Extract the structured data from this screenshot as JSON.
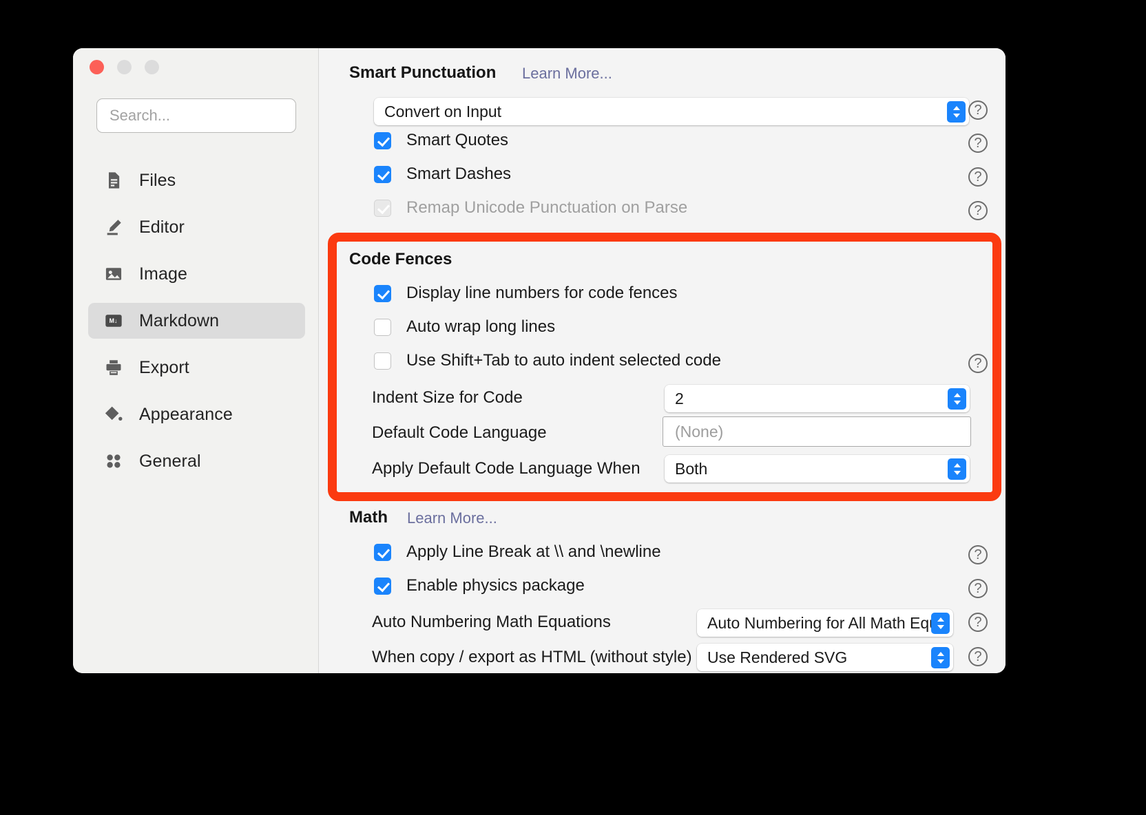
{
  "window": {
    "traffic_lights": [
      "close",
      "minimize",
      "zoom"
    ]
  },
  "sidebar": {
    "search": {
      "placeholder": "Search...",
      "value": ""
    },
    "items": [
      {
        "label": "Files",
        "icon": "file-document-icon",
        "selected": false
      },
      {
        "label": "Editor",
        "icon": "pencil-icon",
        "selected": false
      },
      {
        "label": "Image",
        "icon": "image-icon",
        "selected": false
      },
      {
        "label": "Markdown",
        "icon": "markdown-icon",
        "selected": true
      },
      {
        "label": "Export",
        "icon": "printer-icon",
        "selected": false
      },
      {
        "label": "Appearance",
        "icon": "paint-bucket-icon",
        "selected": false
      },
      {
        "label": "General",
        "icon": "people-icon",
        "selected": false
      }
    ]
  },
  "sections": {
    "smart_punctuation": {
      "title": "Smart Punctuation",
      "learn_more": "Learn More...",
      "convert_mode": "Convert on Input",
      "smart_quotes": "Smart Quotes",
      "smart_dashes": "Smart Dashes",
      "remap_unicode": "Remap Unicode Punctuation on Parse"
    },
    "code_fences": {
      "title": "Code Fences",
      "display_line_numbers": "Display line numbers for code fences",
      "auto_wrap": "Auto wrap long lines",
      "shift_tab": "Use Shift+Tab to auto indent selected code",
      "indent_size_label": "Indent Size for Code",
      "indent_size_value": "2",
      "default_lang_label": "Default Code Language",
      "default_lang_placeholder": "(None)",
      "apply_when_label": "Apply Default Code Language When",
      "apply_when_value": "Both"
    },
    "math": {
      "title": "Math",
      "learn_more": "Learn More...",
      "line_break": "Apply Line Break at \\\\ and \\newline",
      "physics": "Enable physics package",
      "auto_numbering_label": "Auto Numbering Math Equations",
      "auto_numbering_value": "Auto Numbering for All Math Equ",
      "copy_export_label": "When copy / export as HTML (without style)",
      "copy_export_value": "Use Rendered SVG"
    }
  },
  "annotation": {
    "highlight_color": "#fb3a10",
    "target": "Code Fences"
  },
  "icons": {
    "help": "?"
  },
  "colors": {
    "accent": "#1a84fc",
    "window_bg": "#f4f4f4",
    "sidebar_bg": "#f2f2f0",
    "selected_bg": "#dcdcdc",
    "link": "#6b6f9e"
  }
}
